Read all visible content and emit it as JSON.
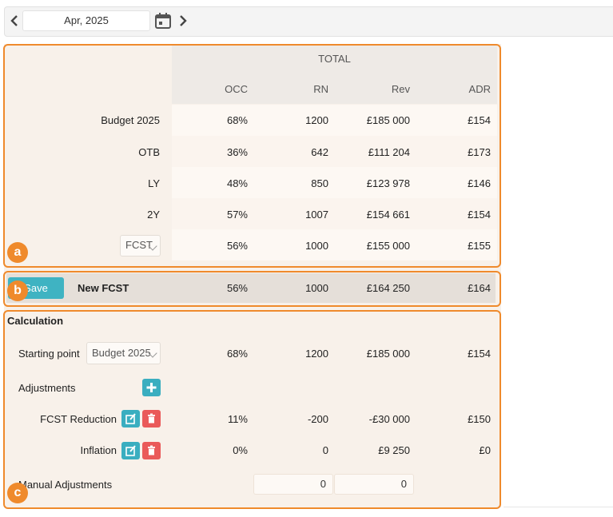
{
  "toolbar": {
    "date": "Apr, 2025"
  },
  "table": {
    "group_header": "TOTAL",
    "columns": [
      "OCC",
      "RN",
      "Rev",
      "ADR"
    ],
    "rows": [
      {
        "label": "Budget 2025",
        "values": [
          "68%",
          "1200",
          "£185 000",
          "£154"
        ]
      },
      {
        "label": "OTB",
        "values": [
          "36%",
          "642",
          "£111 204",
          "£173"
        ]
      },
      {
        "label": "LY",
        "values": [
          "48%",
          "850",
          "£123 978",
          "£146"
        ]
      },
      {
        "label": "2Y",
        "values": [
          "57%",
          "1007",
          "£154 661",
          "£154"
        ]
      },
      {
        "label": "FCST",
        "values": [
          "56%",
          "1000",
          "£155 000",
          "£155"
        ]
      }
    ]
  },
  "new_fcst": {
    "save_label": "Save",
    "label": "New FCST",
    "values": [
      "56%",
      "1000",
      "£164 250",
      "£164"
    ]
  },
  "calculation": {
    "title": "Calculation",
    "starting_point": {
      "label": "Starting point",
      "select": "Budget 2025",
      "values": [
        "68%",
        "1200",
        "£185 000",
        "£154"
      ]
    },
    "adjustments_label": "Adjustments",
    "adjustments": [
      {
        "label": "FCST Reduction",
        "values": [
          "11%",
          "-200",
          "-£30 000",
          "£150"
        ]
      },
      {
        "label": "Inflation",
        "values": [
          "0%",
          "0",
          "£9 250",
          "£0"
        ]
      }
    ],
    "manual": {
      "label": "Manual Adjustments",
      "inputs": [
        "0",
        "0"
      ]
    }
  },
  "badges": {
    "a": "a",
    "b": "b",
    "c": "c"
  },
  "colors": {
    "highlight": "#ef8a2c",
    "teal": "#3aaec0",
    "red": "#ea5a5a"
  },
  "icons": [
    "chevron-left-icon",
    "calendar-icon",
    "chevron-right-icon",
    "plus-icon",
    "edit-icon",
    "trash-icon"
  ]
}
